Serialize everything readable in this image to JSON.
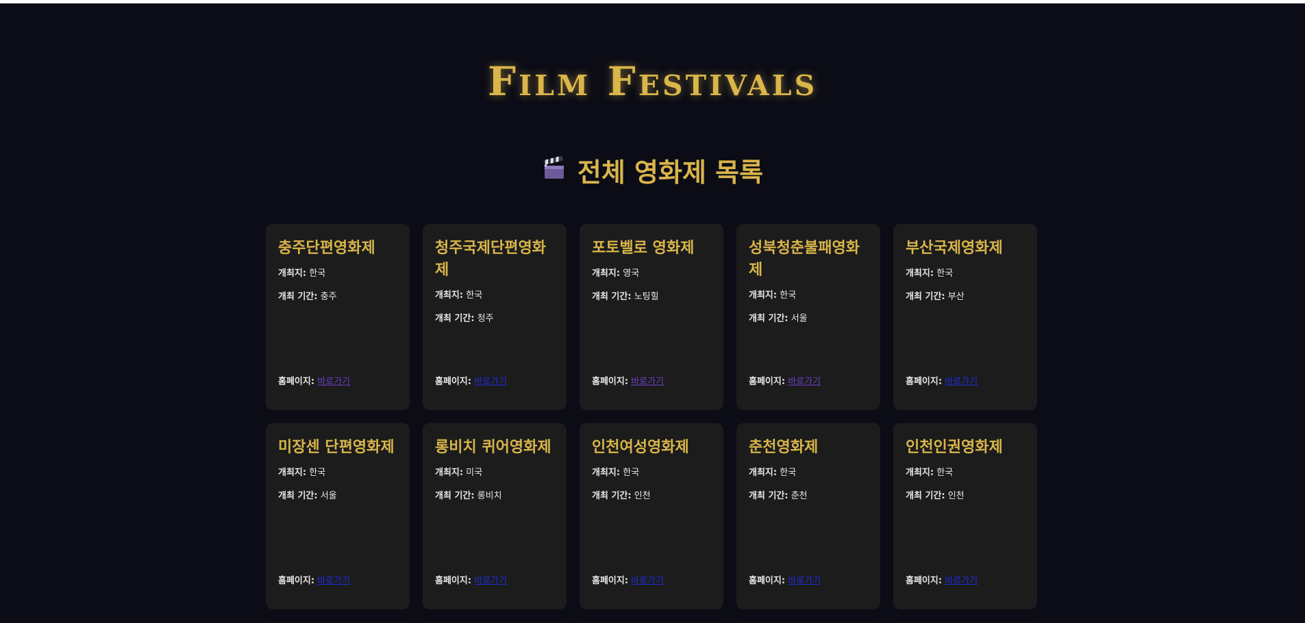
{
  "site": {
    "title": "Film Festivals"
  },
  "section": {
    "icon": "clapper-board-icon",
    "heading": "전체 영화제 목록"
  },
  "labels": {
    "location": "개최지:",
    "period": "개최 기간:",
    "homepage": "홈페이지:",
    "link": "바로가기"
  },
  "colors": {
    "background": "#0b0c16",
    "card": "#1c1c1c",
    "accent_gold": "#d9b54a",
    "link_visited": "#6b3ec7",
    "link_unvisited": "#1f2bd8"
  },
  "festivals": [
    {
      "name": "충주단편영화제",
      "location": "한국",
      "period": "충주",
      "link_visited": true
    },
    {
      "name": "청주국제단편영화제",
      "location": "한국",
      "period": "청주",
      "link_visited": false
    },
    {
      "name": "포토벨로 영화제",
      "location": "영국",
      "period": "노팅힐",
      "link_visited": true
    },
    {
      "name": "성북청춘불패영화제",
      "location": "한국",
      "period": "서울",
      "link_visited": true
    },
    {
      "name": "부산국제영화제",
      "location": "한국",
      "period": "부산",
      "link_visited": false
    },
    {
      "name": "미장센 단편영화제",
      "location": "한국",
      "period": "서울",
      "link_visited": false
    },
    {
      "name": "롱비치 퀴어영화제",
      "location": "미국",
      "period": "롱비치",
      "link_visited": false
    },
    {
      "name": "인천여성영화제",
      "location": "한국",
      "period": "인천",
      "link_visited": false
    },
    {
      "name": "춘천영화제",
      "location": "한국",
      "period": "춘천",
      "link_visited": false
    },
    {
      "name": "인천인권영화제",
      "location": "한국",
      "period": "인천",
      "link_visited": false
    }
  ]
}
